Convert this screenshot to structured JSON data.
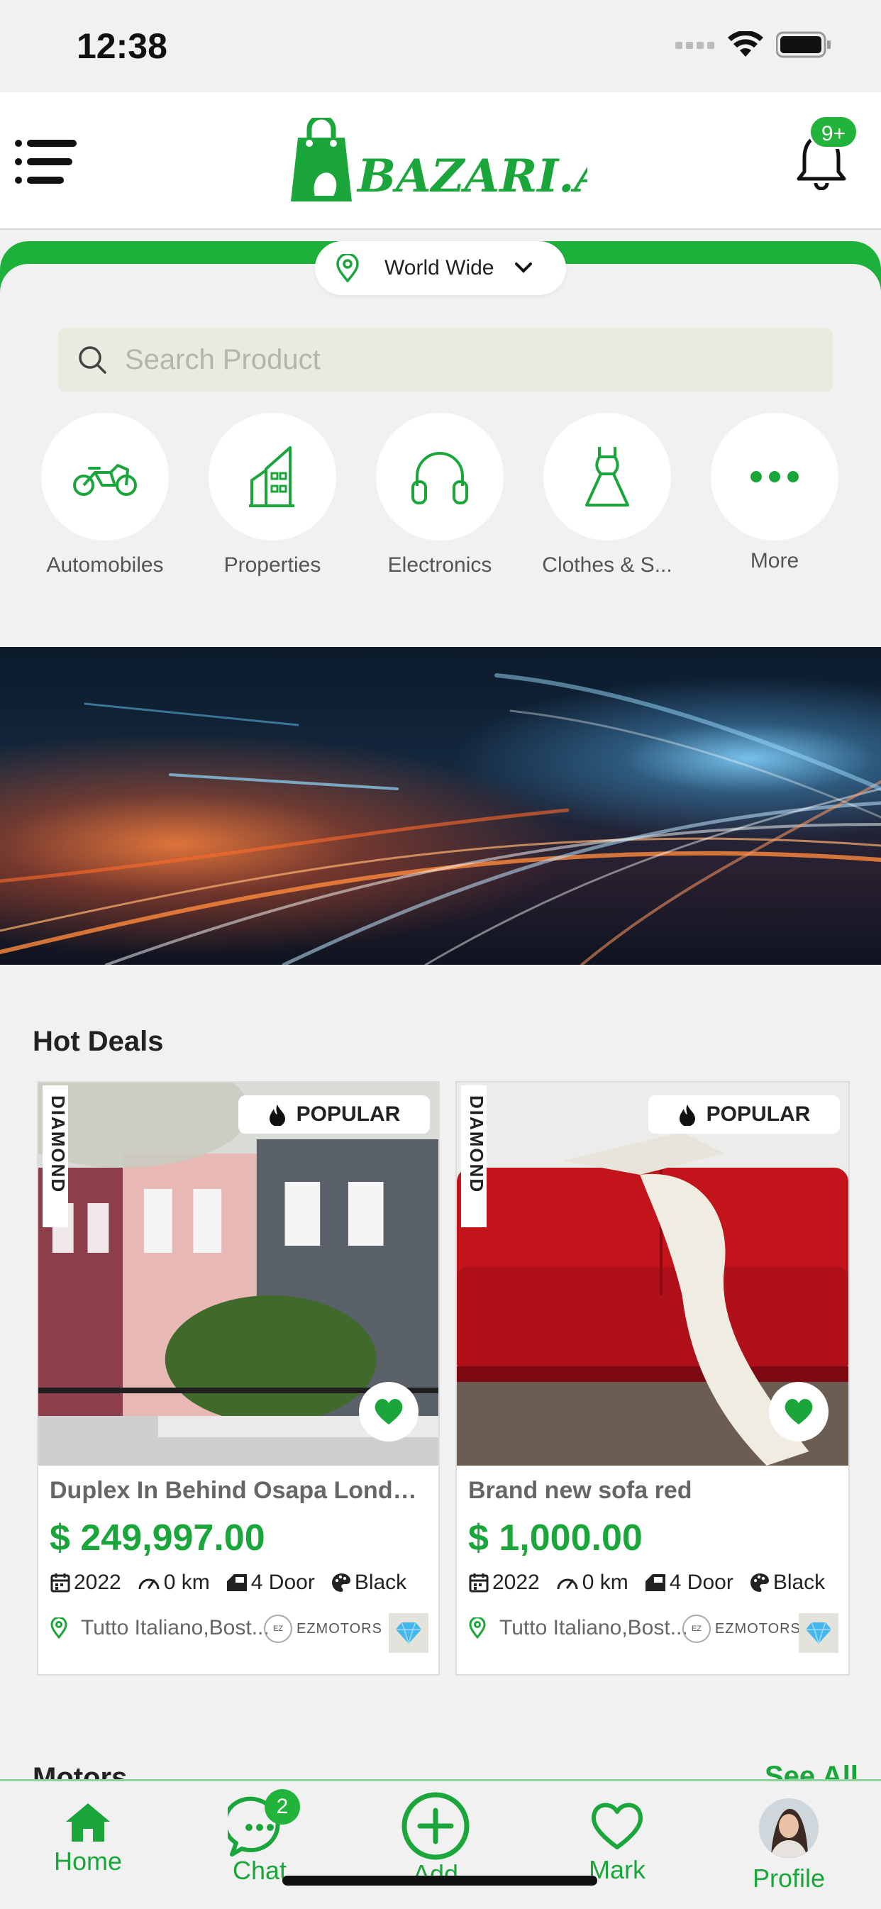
{
  "status_bar": {
    "time": "12:38"
  },
  "header": {
    "logo_text": "BAZARI.AZ",
    "notification_badge": "9+"
  },
  "location": {
    "label": "World Wide"
  },
  "search": {
    "placeholder": "Search Product"
  },
  "categories": [
    {
      "label": "Automobiles",
      "icon": "motorcycle-icon"
    },
    {
      "label": "Properties",
      "icon": "building-icon"
    },
    {
      "label": "Electronics",
      "icon": "headphones-icon"
    },
    {
      "label": "Clothes & S...",
      "icon": "dress-icon"
    },
    {
      "label": "More",
      "icon": "more-dots-icon"
    }
  ],
  "hot_deals": {
    "title": "Hot Deals",
    "cards": [
      {
        "tier": "DIAMOND",
        "badge": "POPULAR",
        "title": "Duplex In Behind Osapa Londo...",
        "price": "$ 249,997.00",
        "year": "2022",
        "mileage": "0 km",
        "doors": "4 Door",
        "color": "Black",
        "location": "Tutto Italiano,Bost...",
        "seller_mark": "EZ",
        "seller": "EZMOTORS"
      },
      {
        "tier": "DIAMOND",
        "badge": "POPULAR",
        "title": "Brand new sofa red",
        "price": "$ 1,000.00",
        "year": "2022",
        "mileage": "0 km",
        "doors": "4 Door",
        "color": "Black",
        "location": "Tutto Italiano,Bost...",
        "seller_mark": "EZ",
        "seller": "EZMOTORS"
      }
    ]
  },
  "motors": {
    "title": "Motors",
    "see_all": "See All"
  },
  "bottom_nav": {
    "home": "Home",
    "chat": "Chat",
    "chat_badge": "2",
    "add": "Add",
    "mark": "Mark",
    "profile": "Profile"
  },
  "colors": {
    "brand_green": "#1aa63a",
    "accent_green": "#22b33a",
    "background": "#f1f1f1"
  }
}
